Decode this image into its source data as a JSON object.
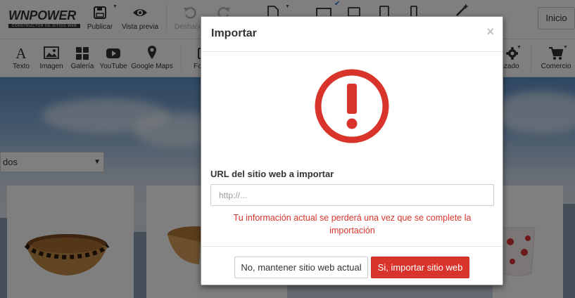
{
  "brand": {
    "name": "WNPOWER",
    "tagline": "CONSTRUCTOR DE SITIOS WEB"
  },
  "toolbar": {
    "publish_label": "Publicar",
    "preview_label": "Vista previa",
    "undo_label": "Deshacer",
    "home_button": "Inicio"
  },
  "widgets": [
    {
      "label": "Texto",
      "icon": "text-icon"
    },
    {
      "label": "Imagen",
      "icon": "image-icon"
    },
    {
      "label": "Galería",
      "icon": "gallery-icon"
    },
    {
      "label": "YouTube",
      "icon": "youtube-icon"
    },
    {
      "label": "Google Maps",
      "icon": "map-marker-icon"
    },
    {
      "label": "Fo",
      "icon": "form-icon"
    },
    {
      "label": "nzado",
      "icon": "advanced-icon"
    },
    {
      "label": "Comercio",
      "icon": "cart-icon"
    }
  ],
  "canvas": {
    "sort_select_value": "dos"
  },
  "modal": {
    "title": "Importar",
    "close_symbol": "×",
    "url_label": "URL del sitio web a importar",
    "url_value": "",
    "url_placeholder": "http://...",
    "warning": "Tu información actual se perderá una vez que se complete la importación",
    "keep_button": "No, mantener sitio web actual",
    "import_button": "Si, importar sitio web"
  },
  "colors": {
    "danger": "#d9342b",
    "text": "#333333"
  }
}
